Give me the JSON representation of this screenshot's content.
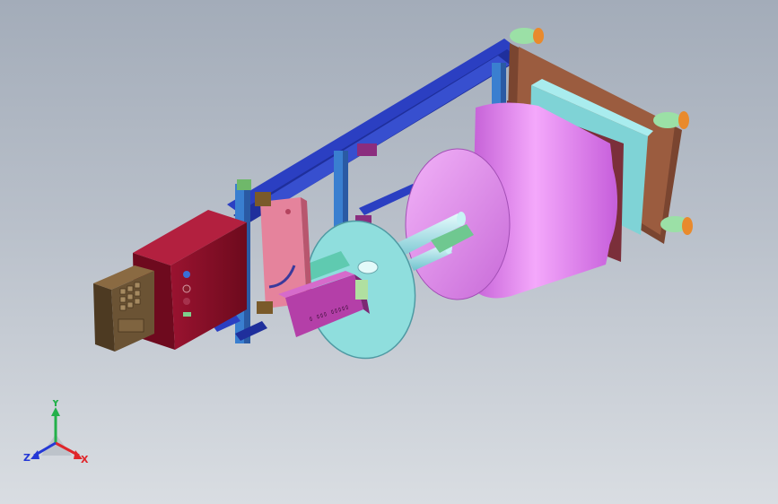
{
  "view": {
    "background_top": "#a3acb9",
    "background_bottom": "#d9dde2"
  },
  "parts": {
    "frame_rail_color": "#2b3fc2",
    "frame_post_color": "#3a7fd0",
    "back_plate_color": "#9b5c3f",
    "panel_color": "#7fd3d6",
    "drum_color": "#e07ef0",
    "disc_color": "#8fdedd",
    "shaft_color": "#a9ecf1",
    "control_box_color": "#8a0e26",
    "keypad_color": "#6b5334",
    "bracket_color": "#e5839c",
    "motor_color": "#b43fa8",
    "foot_color": "#9be0a6",
    "foot_cap_color": "#e98a2c"
  },
  "triad": {
    "x_label": "X",
    "y_label": "Y",
    "z_label": "Z",
    "x_color": "#e0262b",
    "y_color": "#23b04a",
    "z_color": "#2438d6"
  }
}
